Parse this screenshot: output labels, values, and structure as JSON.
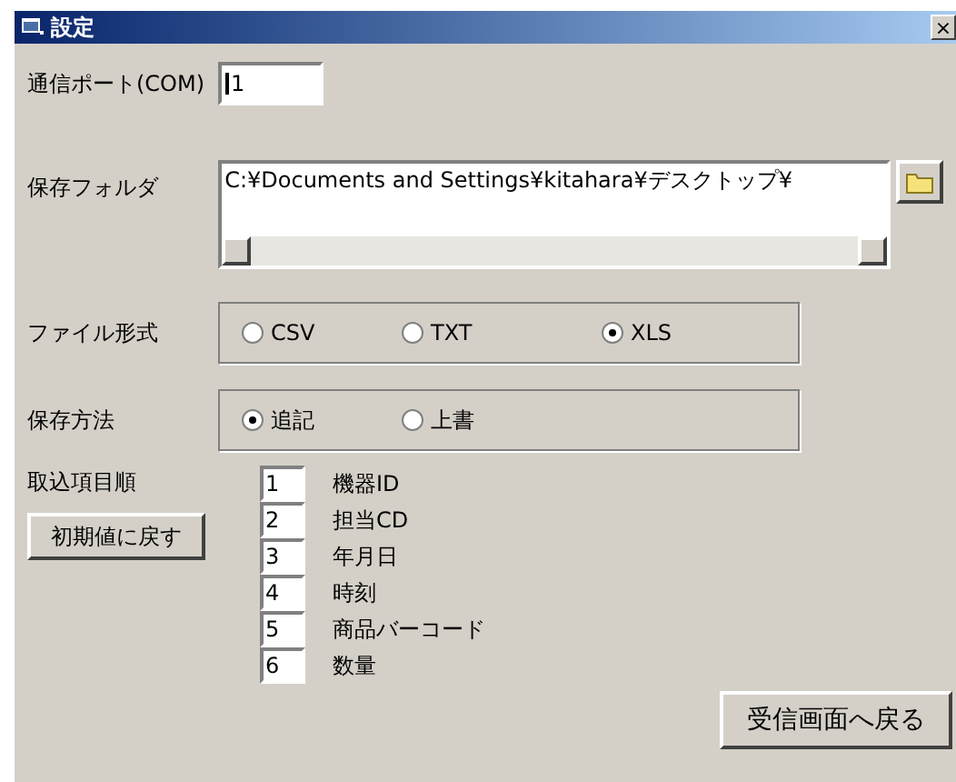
{
  "window": {
    "title": "設定",
    "close": "×"
  },
  "com_port": {
    "label": "通信ポート(COM)",
    "value": "1"
  },
  "save_folder": {
    "label": "保存フォルダ",
    "value": "C:¥Documents and Settings¥kitahara¥デスクトップ¥"
  },
  "file_format": {
    "label": "ファイル形式",
    "options": [
      {
        "label": "CSV",
        "selected": false
      },
      {
        "label": "TXT",
        "selected": false
      },
      {
        "label": "XLS",
        "selected": true
      }
    ]
  },
  "save_method": {
    "label": "保存方法",
    "options": [
      {
        "label": "追記",
        "selected": true
      },
      {
        "label": "上書",
        "selected": false
      }
    ]
  },
  "import_order": {
    "label": "取込項目順",
    "reset_button": "初期値に戻す",
    "items": [
      {
        "value": "1",
        "label": "機器ID"
      },
      {
        "value": "2",
        "label": "担当CD"
      },
      {
        "value": "3",
        "label": "年月日"
      },
      {
        "value": "4",
        "label": "時刻"
      },
      {
        "value": "5",
        "label": "商品バーコード"
      },
      {
        "value": "6",
        "label": "数量"
      }
    ]
  },
  "back_button": "受信画面へ戻る"
}
